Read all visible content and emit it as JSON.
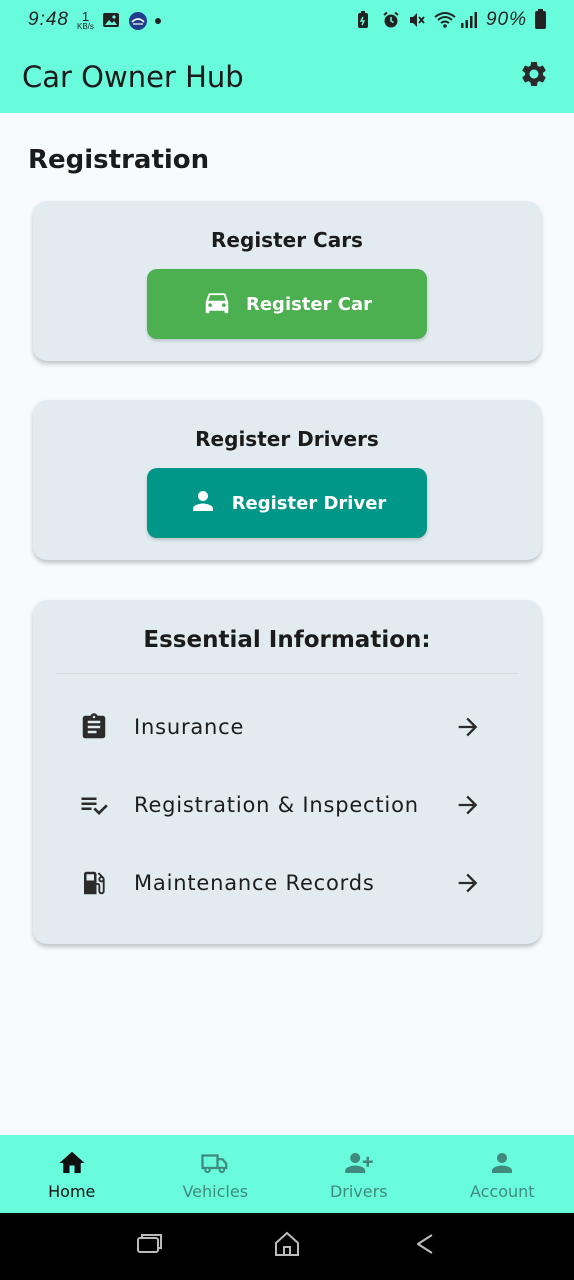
{
  "status_bar": {
    "time": "9:48",
    "net_speed": "1",
    "net_unit": "KB/s",
    "battery": "90%"
  },
  "app_bar": {
    "title": "Car Owner Hub",
    "settings_icon": "gear-icon"
  },
  "section": {
    "title": "Registration"
  },
  "register_car_card": {
    "heading": "Register Cars",
    "button_label": "Register Car",
    "button_icon": "car-icon",
    "button_color": "#4caf50"
  },
  "register_driver_card": {
    "heading": "Register Drivers",
    "button_label": "Register Driver",
    "button_icon": "person-icon",
    "button_color": "#009688"
  },
  "info_card": {
    "heading": "Essential Information:",
    "items": [
      {
        "label": "Insurance",
        "icon": "clipboard-icon"
      },
      {
        "label": "Registration & Inspection",
        "icon": "checklist-icon"
      },
      {
        "label": "Maintenance Records",
        "icon": "fuel-pump-icon"
      }
    ]
  },
  "bottom_nav": {
    "items": [
      {
        "label": "Home",
        "icon": "home-icon",
        "active": true
      },
      {
        "label": "Vehicles",
        "icon": "truck-icon",
        "active": false
      },
      {
        "label": "Drivers",
        "icon": "add-person-icon",
        "active": false
      },
      {
        "label": "Account",
        "icon": "person-icon",
        "active": false
      }
    ]
  },
  "colors": {
    "accent": "#69fcdc",
    "card_background": "#e2ecf0",
    "page_background": "#f7fbfd"
  }
}
